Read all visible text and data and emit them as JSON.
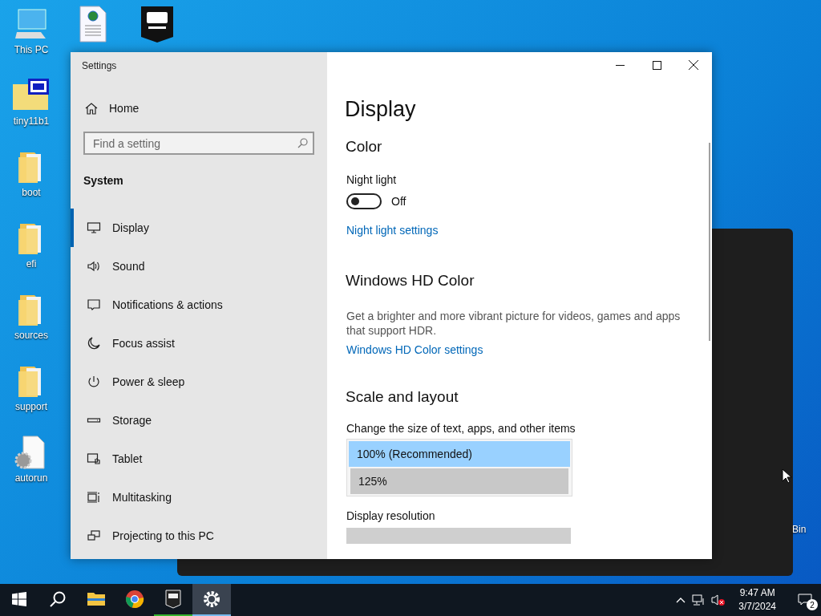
{
  "desktop": {
    "icons": [
      {
        "kind": "pc",
        "label": "This PC"
      },
      {
        "kind": "iso",
        "label": "tiny11b1"
      },
      {
        "kind": "folder",
        "label": "boot"
      },
      {
        "kind": "folder",
        "label": "efi"
      },
      {
        "kind": "folder",
        "label": "sources"
      },
      {
        "kind": "folder",
        "label": "support"
      },
      {
        "kind": "gear-file",
        "label": "autorun"
      }
    ],
    "top_icons": [
      {
        "kind": "web-doc"
      },
      {
        "kind": "epic"
      }
    ],
    "recycle_bin_label": "Bin"
  },
  "window": {
    "title": "Settings",
    "home": "Home",
    "search": {
      "placeholder": "Find a setting"
    },
    "section": "System",
    "sidebar": {
      "items": [
        {
          "kind": "display",
          "label": "Display",
          "selected": true
        },
        {
          "kind": "sound",
          "label": "Sound",
          "selected": false
        },
        {
          "kind": "notify",
          "label": "Notifications & actions",
          "selected": false
        },
        {
          "kind": "moon",
          "label": "Focus assist",
          "selected": false
        },
        {
          "kind": "power",
          "label": "Power & sleep",
          "selected": false
        },
        {
          "kind": "storage",
          "label": "Storage",
          "selected": false
        },
        {
          "kind": "tablet",
          "label": "Tablet",
          "selected": false
        },
        {
          "kind": "multi",
          "label": "Multitasking",
          "selected": false
        },
        {
          "kind": "project",
          "label": "Projecting to this PC",
          "selected": false
        }
      ]
    },
    "content": {
      "title": "Display",
      "color": {
        "heading": "Color",
        "night_light": {
          "label": "Night light",
          "on": false,
          "state_text": "Off"
        },
        "link": "Night light settings"
      },
      "hd_color": {
        "heading": "Windows HD Color",
        "description": "Get a brighter and more vibrant picture for videos, games and apps that support HDR.",
        "link": "Windows HD Color settings"
      },
      "scale": {
        "heading": "Scale and layout",
        "label": "Change the size of text, apps, and other items",
        "options": [
          {
            "label": "100% (Recommended)",
            "selected": true,
            "hovered": false
          },
          {
            "label": "125%",
            "selected": false,
            "hovered": true
          }
        ],
        "resolution_label": "Display resolution"
      }
    }
  },
  "taskbar": {
    "apps": [
      {
        "kind": "search",
        "selected": false,
        "running": false
      },
      {
        "kind": "explorer",
        "selected": false,
        "running": false
      },
      {
        "kind": "chrome",
        "selected": false,
        "running": false
      },
      {
        "kind": "epic",
        "selected": false,
        "running": true
      },
      {
        "kind": "settings",
        "selected": true,
        "running": true
      }
    ],
    "tray": {
      "time": "9:47 AM",
      "date": "3/7/2024",
      "notification_count": "2"
    }
  }
}
